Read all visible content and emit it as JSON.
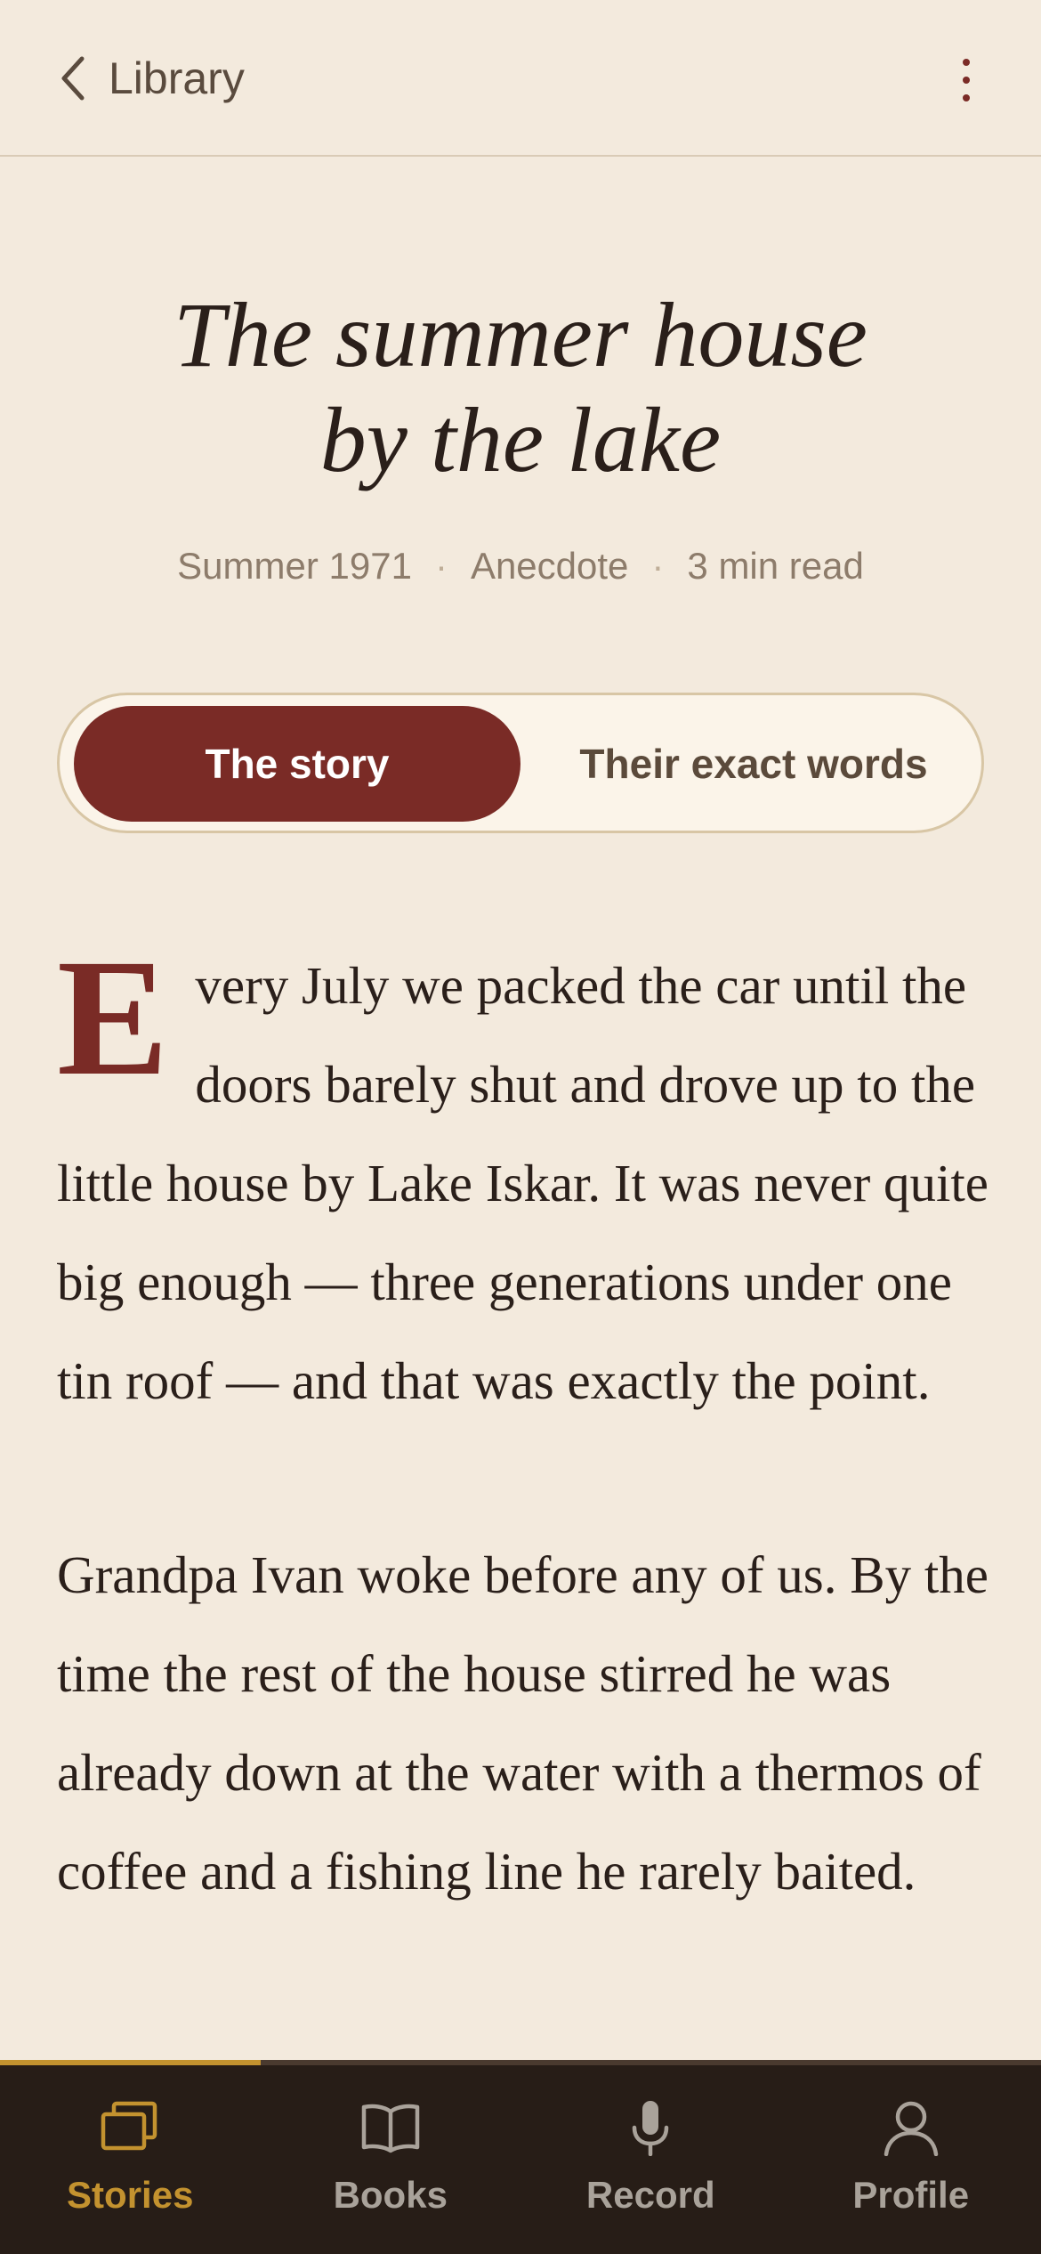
{
  "header": {
    "back_label": "Library"
  },
  "story": {
    "title_line1": "The summer house",
    "title_line2": "by the lake",
    "meta": {
      "date": "Summer 1971",
      "category": "Anecdote",
      "read_time": "3 min read"
    },
    "tabs": [
      {
        "label": "The story",
        "active": true
      },
      {
        "label": "Their exact words",
        "active": false
      }
    ],
    "drop_cap": "E",
    "paragraph1_rest": "very July we packed the car until the doors barely shut and drove up to the little house by Lake Iskar. It was never quite big enough — three generations under one tin roof — and that was exactly the point.",
    "paragraph2": "Grandpa Ivan woke before any of us. By the time the rest of the house stirred he was already down at the water with a thermos of coffee and a fishing line he rarely baited."
  },
  "progress": 0.25,
  "tabbar": {
    "items": [
      {
        "label": "Stories",
        "icon": "stories-icon",
        "active": true
      },
      {
        "label": "Books",
        "icon": "book-icon",
        "active": false
      },
      {
        "label": "Record",
        "icon": "microphone-icon",
        "active": false
      },
      {
        "label": "Profile",
        "icon": "profile-icon",
        "active": false
      }
    ]
  },
  "colors": {
    "background": "#f3eadd",
    "accent": "#7a2b26",
    "gold": "#c3922f",
    "tabbar": "#271d17"
  }
}
